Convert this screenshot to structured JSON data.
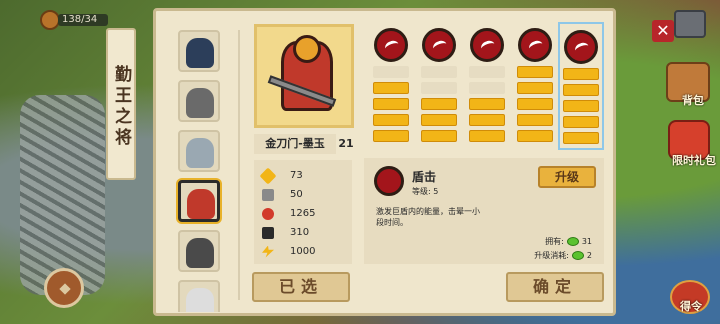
{
  "hud": {
    "gold": "138/34"
  },
  "panel": {
    "title": "勤王之将",
    "hero_name": "金刀门-墨玉",
    "hero_level": "21",
    "stats": [
      {
        "icon": "sword-icon",
        "value": "73"
      },
      {
        "icon": "shield-icon",
        "value": "50"
      },
      {
        "icon": "heart-icon",
        "value": "1265"
      },
      {
        "icon": "boot-icon",
        "value": "310"
      },
      {
        "icon": "lightning-icon",
        "value": "1000"
      }
    ],
    "skills": [
      {
        "icon": "fist-icon",
        "level": 4,
        "max": 5
      },
      {
        "icon": "slash-icon",
        "level": 3,
        "max": 5
      },
      {
        "icon": "claw-icon",
        "level": 3,
        "max": 5
      },
      {
        "icon": "crescent-icon",
        "level": 5,
        "max": 5
      },
      {
        "icon": "shield-burst-icon",
        "level": 5,
        "max": 5,
        "selected": true
      }
    ],
    "detail": {
      "name": "盾击",
      "level_text": "等级: 5",
      "upgrade_label": "升级",
      "description": "激发巨盾内的能量，击晕一小段时间。",
      "own_label": "拥有:",
      "own_value": "31",
      "cost_label": "升级消耗:",
      "cost_value": "2"
    },
    "selected_label": "已选",
    "confirm_label": "确定"
  },
  "side": {
    "close": "✕",
    "backpack_label": "背包",
    "gift_label": "限时礼包",
    "order_label": "得令"
  },
  "colors": {
    "accent": "#f2b517",
    "panel": "#efe6cc",
    "skill_red": "#a3151b"
  }
}
